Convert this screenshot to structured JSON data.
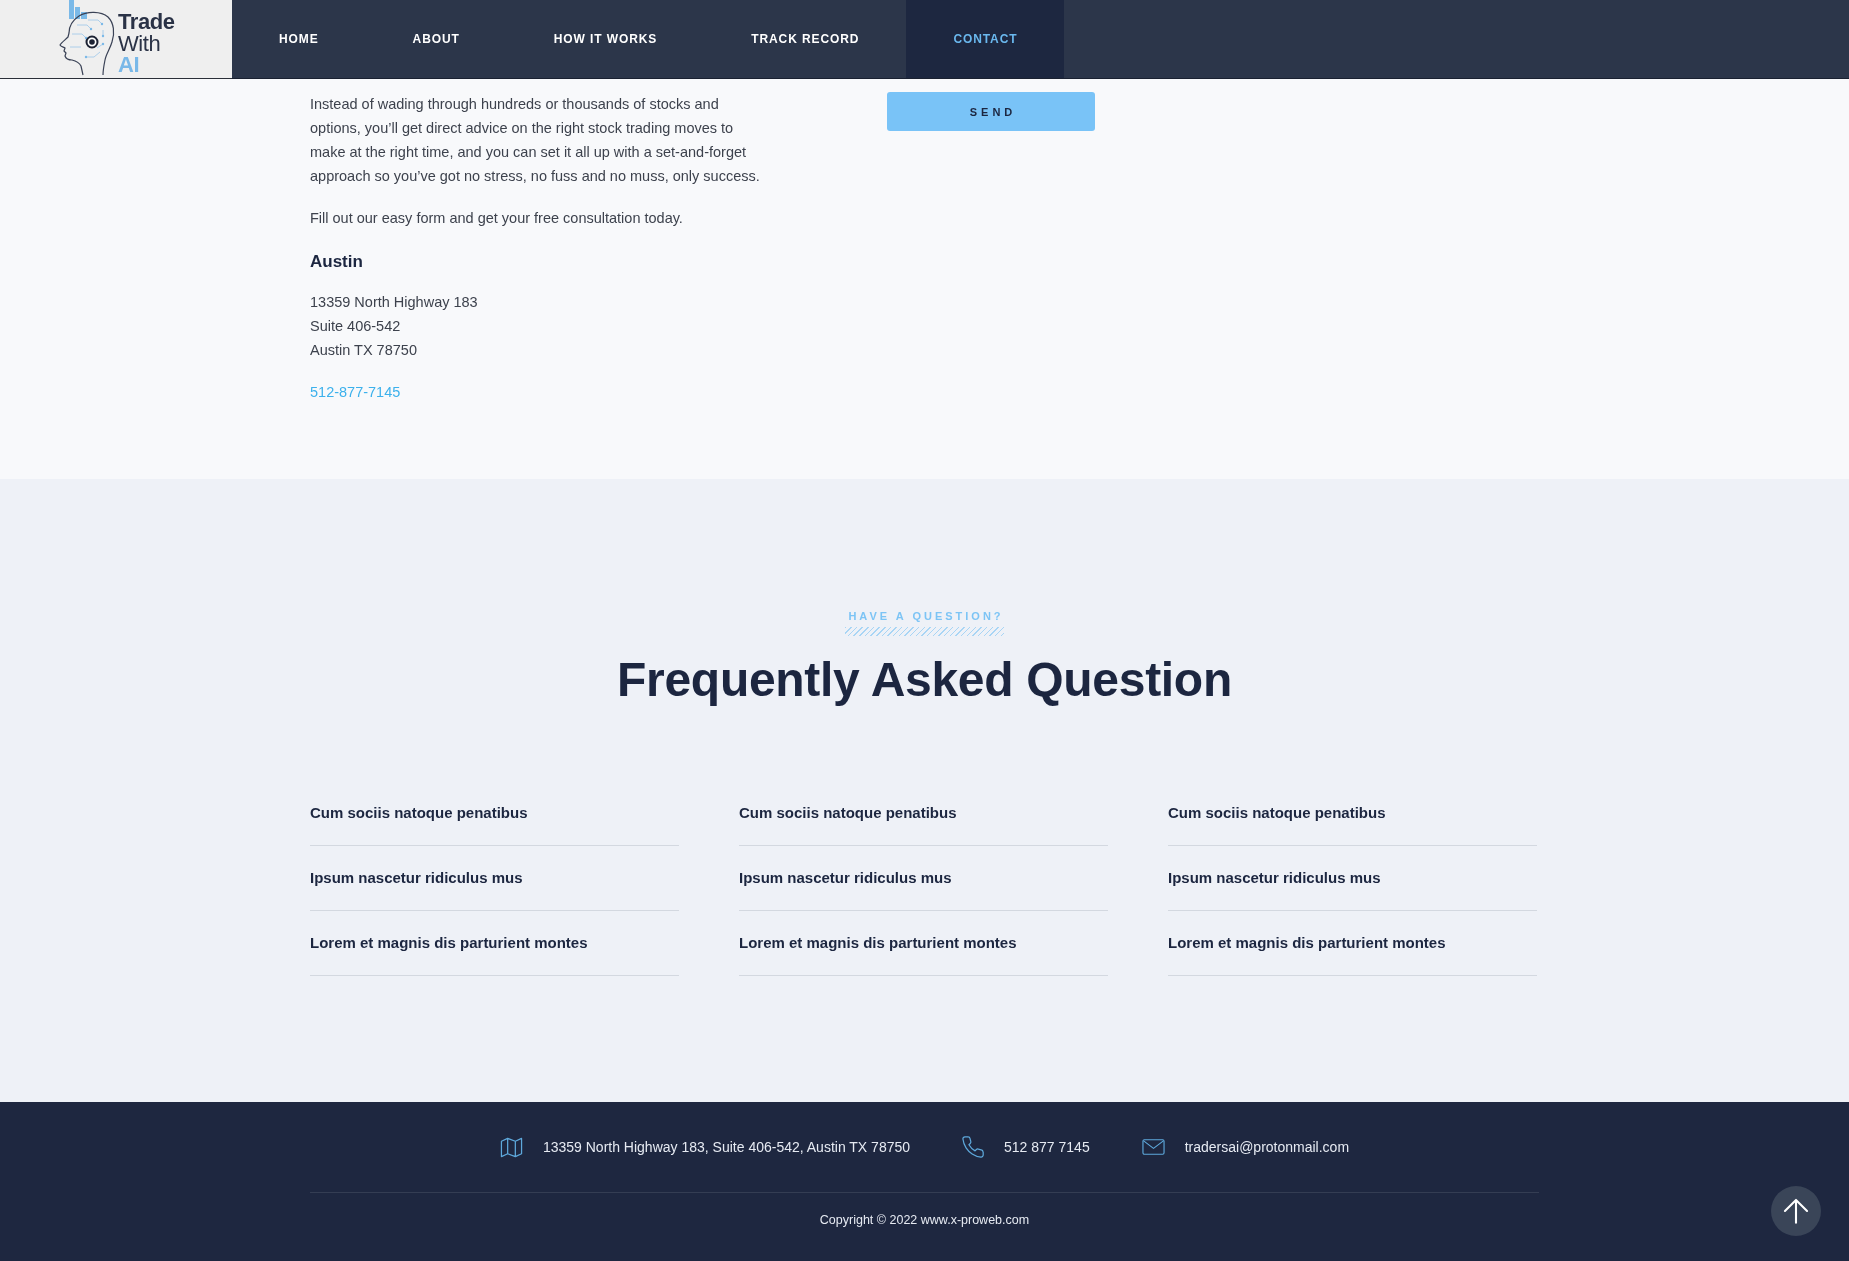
{
  "header": {
    "logo": {
      "lines": [
        {
          "text": "Trade",
          "kind": "strong"
        },
        {
          "text": "With",
          "kind": "regular"
        },
        {
          "text": "AI",
          "kind": "accent"
        }
      ]
    },
    "nav": [
      {
        "label": "HOME",
        "selected": false
      },
      {
        "label": "ABOUT",
        "selected": false
      },
      {
        "label": "HOW IT WORKS",
        "selected": false
      },
      {
        "label": "TRACK RECORD",
        "selected": false
      },
      {
        "label": "CONTACT",
        "selected": true
      }
    ]
  },
  "contact": {
    "intro": "Instead of wading through hundreds or thousands of stocks and options, you’ll get direct advice on the right stock trading moves to make at the right time, and you can set it all up with a set-and-forget approach so you’ve got no stress, no fuss and no muss, only success.",
    "cta": "Fill out our easy form and get your free consultation today.",
    "office": {
      "city": "Austin",
      "address_lines": [
        "13359 North Highway 183",
        "Suite 406-542",
        "Austin TX 78750"
      ],
      "phone": "512-877-7145"
    },
    "form": {
      "submit_label": "SEND"
    }
  },
  "faq": {
    "eyebrow": "HAVE A QUESTION?",
    "title": "Frequently Asked Question",
    "columns": [
      {
        "questions": [
          "Cum sociis natoque penatibus",
          "Ipsum nascetur ridiculus mus",
          "Lorem et magnis dis parturient montes"
        ]
      },
      {
        "questions": [
          "Cum sociis natoque penatibus",
          "Ipsum nascetur ridiculus mus",
          "Lorem et magnis dis parturient montes"
        ]
      },
      {
        "questions": [
          "Cum sociis natoque penatibus",
          "Ipsum nascetur ridiculus mus",
          "Lorem et magnis dis parturient montes"
        ]
      }
    ]
  },
  "footer": {
    "contacts": [
      {
        "kind": "address",
        "text": "13359 North Highway 183, Suite 406-542, Austin TX 78750"
      },
      {
        "kind": "phone",
        "text": "512 877 7145"
      },
      {
        "kind": "email",
        "text": "tradersai@protonmail.com"
      }
    ],
    "copyright": "Copyright © 2022 www.x-proweb.com"
  }
}
